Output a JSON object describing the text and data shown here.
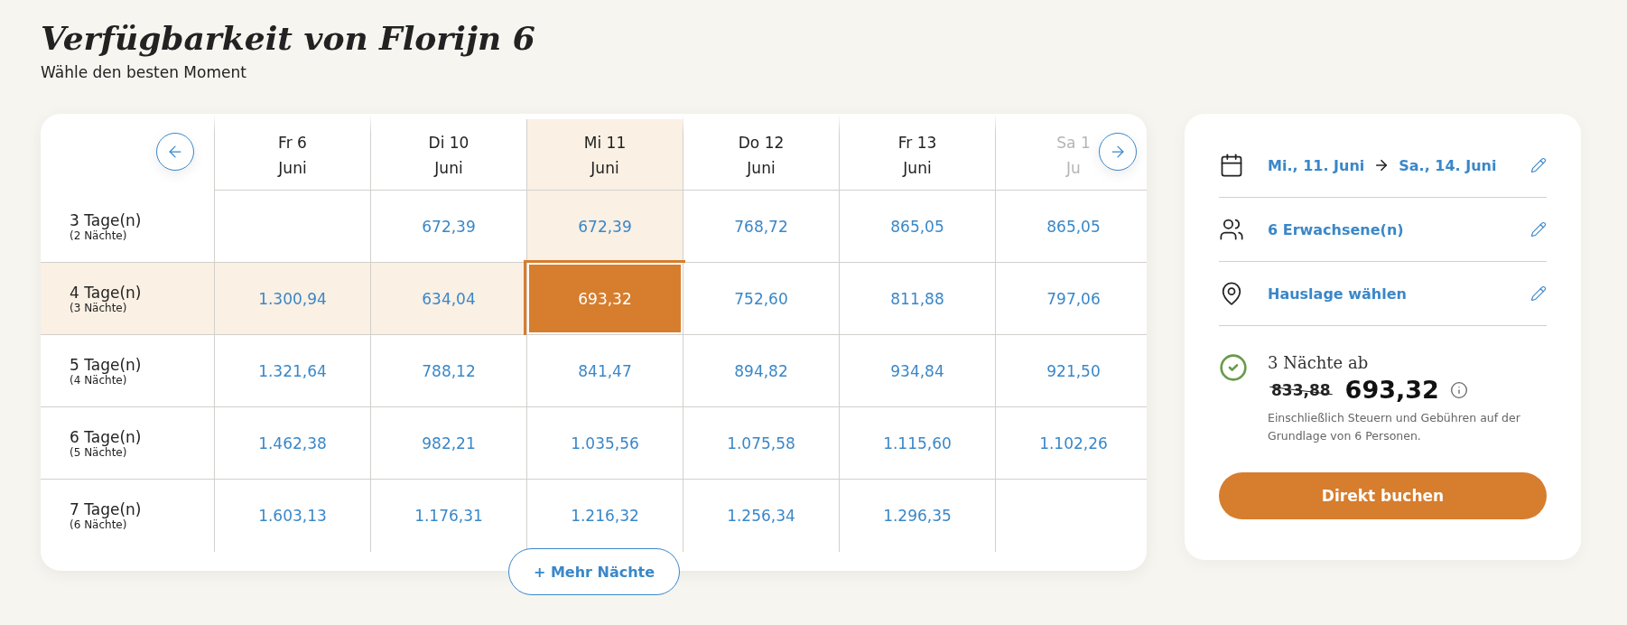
{
  "title": "Verfügbarkeit von Florijn 6",
  "subtitle": "Wähle den besten Moment",
  "columns": [
    {
      "day": "Fr 6",
      "month": "Juni",
      "selected": false,
      "disabled": false
    },
    {
      "day": "Di 10",
      "month": "Juni",
      "selected": false,
      "disabled": false
    },
    {
      "day": "Mi 11",
      "month": "Juni",
      "selected": true,
      "disabled": false
    },
    {
      "day": "Do 12",
      "month": "Juni",
      "selected": false,
      "disabled": false
    },
    {
      "day": "Fr 13",
      "month": "Juni",
      "selected": false,
      "disabled": false
    },
    {
      "day": "Sa 1",
      "month": "Ju",
      "selected": false,
      "disabled": true
    }
  ],
  "rows": [
    {
      "label": "3 Tage(n)",
      "sub": "(2 Nächte)",
      "selected": false,
      "cells": [
        null,
        "672,39",
        "672,39",
        "768,72",
        "865,05",
        "865,05"
      ]
    },
    {
      "label": "4 Tage(n)",
      "sub": "(3 Nächte)",
      "selected": true,
      "cells": [
        "1.300,94",
        "634,04",
        "693,32",
        "752,60",
        "811,88",
        "797,06"
      ]
    },
    {
      "label": "5 Tage(n)",
      "sub": "(4 Nächte)",
      "selected": false,
      "cells": [
        "1.321,64",
        "788,12",
        "841,47",
        "894,82",
        "934,84",
        "921,50"
      ]
    },
    {
      "label": "6 Tage(n)",
      "sub": "(5 Nächte)",
      "selected": false,
      "cells": [
        "1.462,38",
        "982,21",
        "1.035,56",
        "1.075,58",
        "1.115,60",
        "1.102,26"
      ]
    },
    {
      "label": "7 Tage(n)",
      "sub": "(6 Nächte)",
      "selected": false,
      "cells": [
        "1.603,13",
        "1.176,31",
        "1.216,32",
        "1.256,34",
        "1.296,35",
        null
      ]
    }
  ],
  "more_button": "+ Mehr Nächte",
  "summary": {
    "items": [
      {
        "kind": "dates",
        "from": "Mi., 11. Juni",
        "to": "Sa., 14. Juni"
      },
      {
        "kind": "guests",
        "text": "6 Erwachsene(n)"
      },
      {
        "kind": "location",
        "text": "Hauslage wählen"
      }
    ],
    "nights": "3 Nächte ab",
    "old_price": "833,88",
    "price": "693,32",
    "note": "Einschließlich Steuern und Gebühren auf der Grundlage von 6 Personen.",
    "button": "Direkt buchen"
  }
}
